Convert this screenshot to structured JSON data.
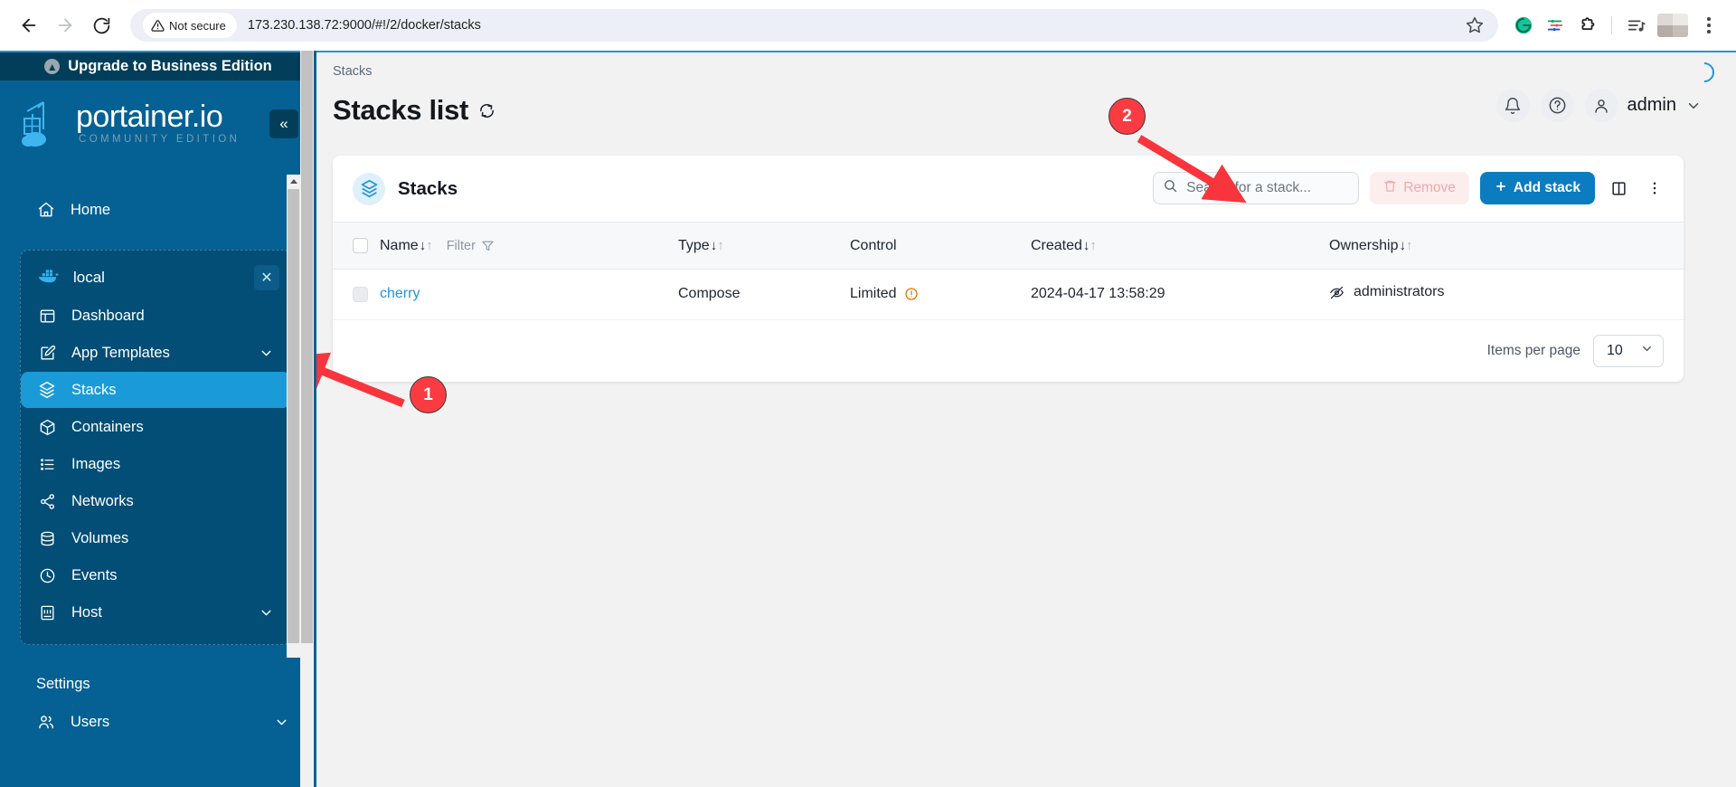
{
  "browser": {
    "back_icon": "back-arrow-icon",
    "forward_icon": "forward-arrow-icon",
    "reload_icon": "reload-icon",
    "security_label": "Not secure",
    "url": "173.230.138.72:9000/#!/2/docker/stacks",
    "bookmark_icon": "star-icon",
    "extensions": [
      "grammarly-icon",
      "filter-extension-icon",
      "puzzle-extension-icon",
      "playlist-icon"
    ],
    "menu_icon": "kebab-menu-icon"
  },
  "sidebar": {
    "upgrade_banner": "Upgrade to Business Edition",
    "brand_name": "portainer.io",
    "brand_subtitle": "COMMUNITY EDITION",
    "collapse_label": "«",
    "home_label": "Home",
    "environment": {
      "name": "local",
      "icon": "docker-whale-icon",
      "close_icon": "close-icon"
    },
    "items": [
      {
        "label": "Dashboard",
        "icon": "dashboard-icon",
        "expandable": false,
        "active": false
      },
      {
        "label": "App Templates",
        "icon": "edit-template-icon",
        "expandable": true,
        "active": false
      },
      {
        "label": "Stacks",
        "icon": "stacks-icon",
        "expandable": false,
        "active": true
      },
      {
        "label": "Containers",
        "icon": "container-box-icon",
        "expandable": false,
        "active": false
      },
      {
        "label": "Images",
        "icon": "images-list-icon",
        "expandable": false,
        "active": false
      },
      {
        "label": "Networks",
        "icon": "networks-share-icon",
        "expandable": false,
        "active": false
      },
      {
        "label": "Volumes",
        "icon": "volumes-database-icon",
        "expandable": false,
        "active": false
      },
      {
        "label": "Events",
        "icon": "clock-icon",
        "expandable": false,
        "active": false
      },
      {
        "label": "Host",
        "icon": "host-server-icon",
        "expandable": true,
        "active": false
      }
    ],
    "settings_title": "Settings",
    "settings_items": [
      {
        "label": "Users",
        "icon": "users-icon",
        "expandable": true
      }
    ]
  },
  "header": {
    "breadcrumb": "Stacks",
    "title": "Stacks list",
    "refresh_icon": "refresh-icon",
    "bell_icon": "bell-icon",
    "help_icon": "help-circle-icon",
    "avatar_icon": "user-avatar-icon",
    "user_name": "admin",
    "caret_icon": "chevron-down-icon"
  },
  "card": {
    "icon": "stacks-icon",
    "title": "Stacks",
    "search_placeholder": "Search for a stack...",
    "search_value": "",
    "search_icon": "search-icon",
    "remove_label": "Remove",
    "remove_icon": "trash-icon",
    "add_label": "Add stack",
    "add_icon": "plus-icon",
    "columns_icon": "columns-layout-icon",
    "more_icon": "kebab-menu-icon"
  },
  "table": {
    "columns": [
      {
        "label": "Name",
        "sortable": true
      },
      {
        "label": "Type",
        "sortable": true
      },
      {
        "label": "Control",
        "sortable": false
      },
      {
        "label": "Created",
        "sortable": true
      },
      {
        "label": "Ownership",
        "sortable": true
      }
    ],
    "filter_label": "Filter",
    "filter_icon": "funnel-icon",
    "rows": [
      {
        "name": "cherry",
        "type": "Compose",
        "control": "Limited",
        "control_icon": "warning-circle-icon",
        "created": "2024-04-17 13:58:29",
        "ownership": "administrators",
        "ownership_icon": "eye-off-icon"
      }
    ]
  },
  "footer": {
    "items_per_page_label": "Items per page",
    "items_per_page_value": "10",
    "caret_icon": "chevron-down-icon"
  },
  "annotations": [
    {
      "number": "1",
      "target": "sidebar-item-stacks"
    },
    {
      "number": "2",
      "target": "add-stack-button"
    }
  ],
  "colors": {
    "sidebar_bg": "#056193",
    "sidebar_banner": "#023e59",
    "accent_blue": "#2196d6",
    "primary_button": "#0c7cc0",
    "active_nav": "#1a9bd7",
    "annotation_red": "#fa3c42",
    "link": "#2196d6",
    "warning": "#d97706"
  }
}
